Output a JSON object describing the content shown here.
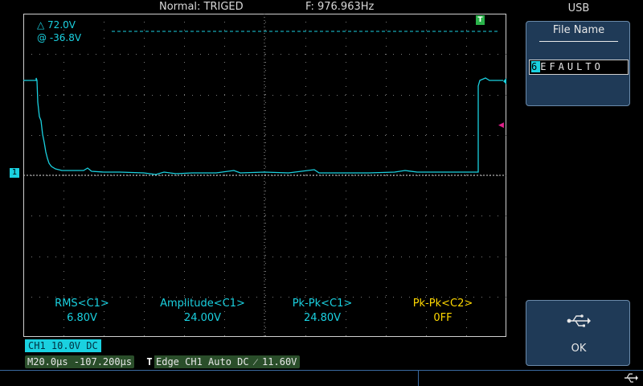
{
  "status": {
    "mode": "Normal: TRIGED",
    "frequency": "F: 976.963Hz"
  },
  "panel": {
    "title": "USB",
    "file_name_label": "File Name",
    "file_name_cursor": "6",
    "file_name_rest": "EFAULTO",
    "ok_label": "OK"
  },
  "cursor": {
    "delta": "△ 72.0V",
    "at": "@ -36.8V"
  },
  "markers": {
    "trigger": "T",
    "channel": "1"
  },
  "measurements": [
    {
      "label": "RMS<C1>",
      "value": "6.80V"
    },
    {
      "label": "Amplitude<C1>",
      "value": "24.00V"
    },
    {
      "label": "Pk-Pk<C1>",
      "value": "24.80V"
    },
    {
      "label": "Pk-Pk<C2>",
      "value": "0FF"
    }
  ],
  "info": {
    "ch1": "CH1 10.0V DC",
    "timebase": "M20.0μs -107.200μs",
    "trigger_t": "T",
    "trigger": "Edge CH1 Auto DC ⁄ 11.60V"
  },
  "colors": {
    "ch1": "#1ad1e0",
    "ch2": "#ffd800",
    "panel": "#1f3a57",
    "trigger": "#2ab34a"
  },
  "icons": {
    "usb": "usb-icon",
    "usb_status": "usb-status-icon"
  }
}
